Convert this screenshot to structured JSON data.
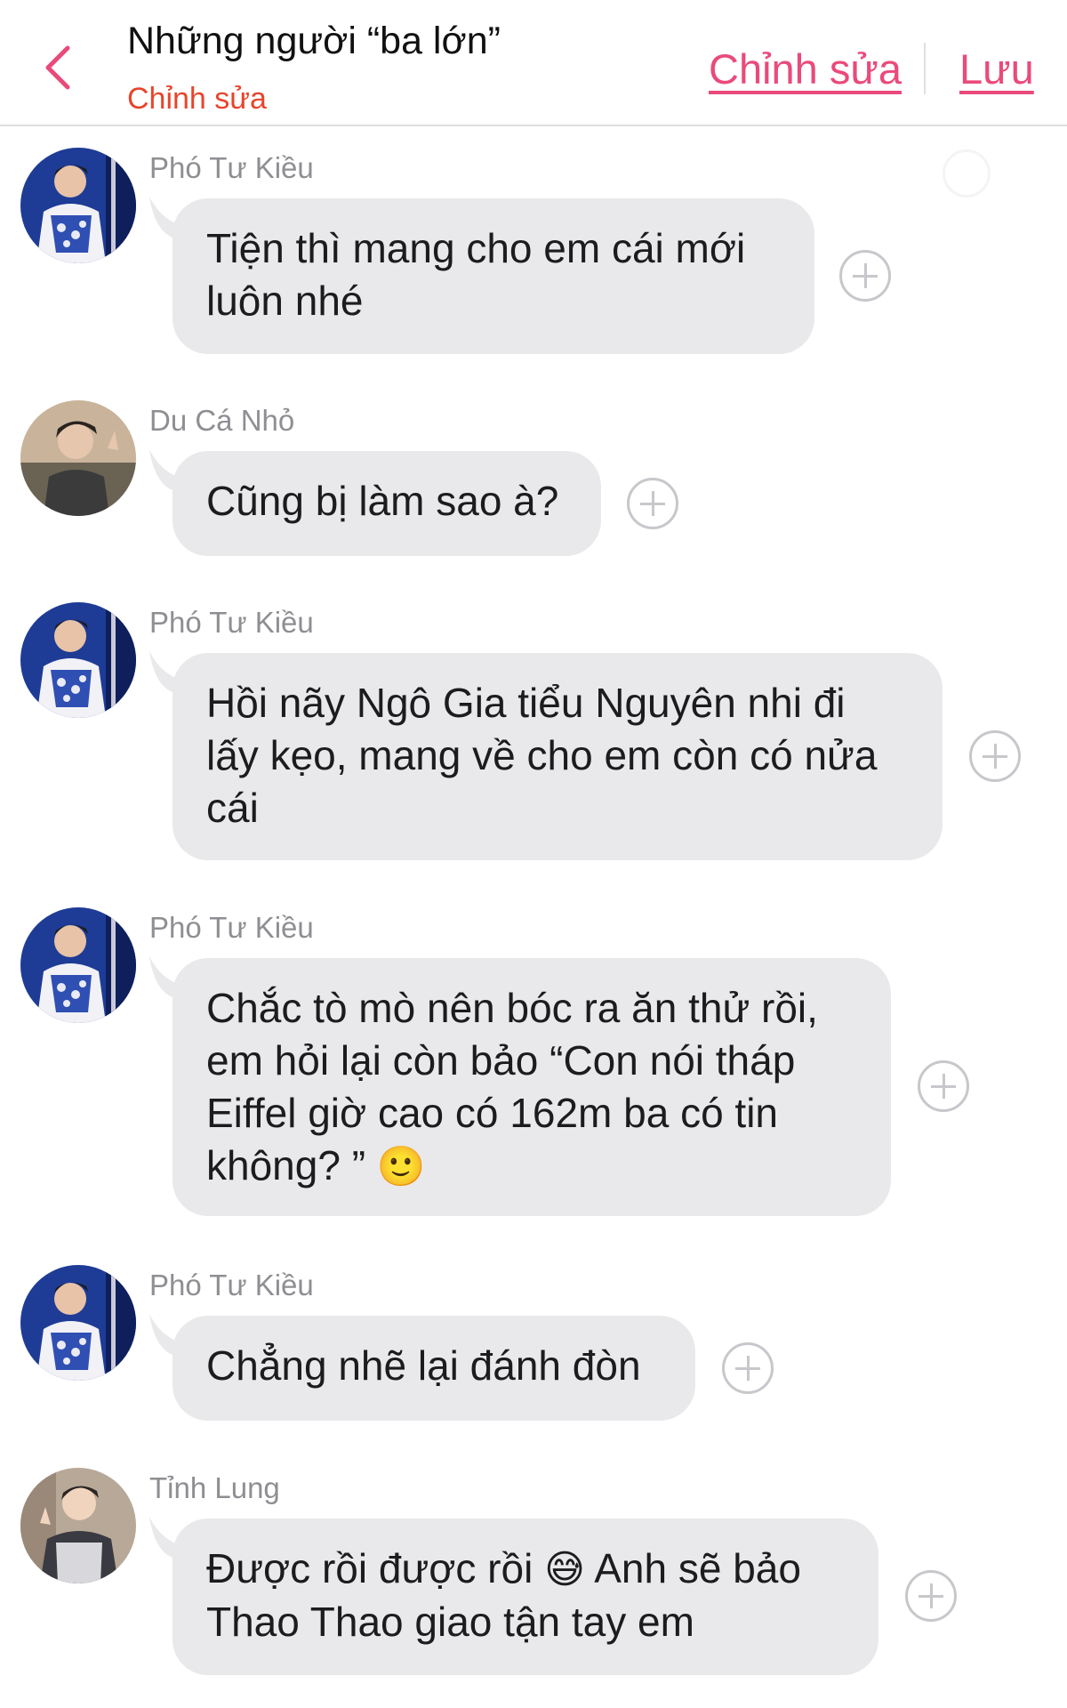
{
  "header": {
    "title": "Những người “ba lớn”",
    "subtitle": "Chỉnh sửa",
    "edit_label": "Chỉnh sửa",
    "save_label": "Lưu",
    "back_icon": "chevron-left-icon",
    "accent_color": "#ea4a7b",
    "subtitle_color": "#e8452c"
  },
  "messages": [
    {
      "sender": "Phó Tư Kiều",
      "text": "Tiện thì mang cho em cái mới luôn nhé"
    },
    {
      "sender": "Du Cá Nhỏ",
      "text": "Cũng bị làm sao à?"
    },
    {
      "sender": "Phó Tư Kiều",
      "text": "Hồi nãy Ngô Gia tiểu Nguyên nhi đi lấy kẹo, mang về cho em còn có nửa cái"
    },
    {
      "sender": "Phó Tư Kiều",
      "text": "Chắc tò mò nên bóc ra ăn thử rồi, em hỏi lại còn bảo “Con nói tháp Eiffel giờ cao có 162m ba có tin không? ”",
      "emoji": "🙂"
    },
    {
      "sender": "Phó Tư Kiều",
      "text": "Chẳng nhẽ lại đánh đòn"
    },
    {
      "sender": "Tỉnh Lung",
      "text": "Được rồi được rồi",
      "emoji": "😅",
      "text_after": "Anh sẽ bảo Thao Thao giao tận tay em"
    }
  ],
  "colors": {
    "bubble": "#e9e9eb",
    "bubble_text": "#1c1c1e",
    "sender_text": "#8e8e93",
    "add_button": "#c7c7cc"
  }
}
